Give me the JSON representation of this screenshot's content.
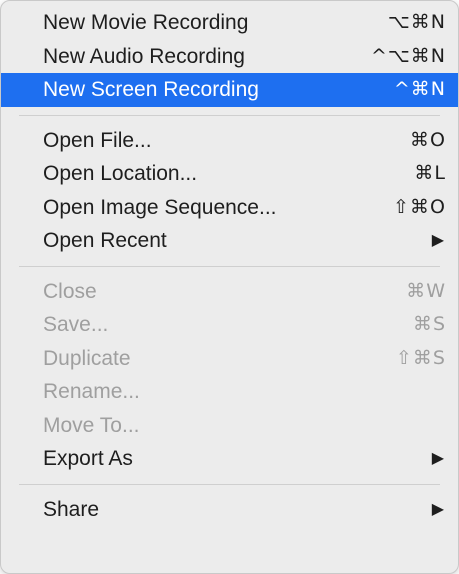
{
  "menu": {
    "groups": [
      [
        {
          "label": "New Movie Recording",
          "shortcut": "⌥⌘N",
          "state": "normal"
        },
        {
          "label": "New Audio Recording",
          "shortcut": "^⌥⌘N",
          "state": "normal"
        },
        {
          "label": "New Screen Recording",
          "shortcut": "^⌘N",
          "state": "highlighted"
        }
      ],
      [
        {
          "label": "Open File...",
          "shortcut": "⌘O",
          "state": "normal"
        },
        {
          "label": "Open Location...",
          "shortcut": "⌘L",
          "state": "normal"
        },
        {
          "label": "Open Image Sequence...",
          "shortcut": "⇧⌘O",
          "state": "normal"
        },
        {
          "label": "Open Recent",
          "submenu_arrow": "▶",
          "state": "normal"
        }
      ],
      [
        {
          "label": "Close",
          "shortcut": "⌘W",
          "state": "disabled"
        },
        {
          "label": "Save...",
          "shortcut": "⌘S",
          "state": "disabled"
        },
        {
          "label": "Duplicate",
          "shortcut": "⇧⌘S",
          "state": "disabled"
        },
        {
          "label": "Rename...",
          "state": "disabled"
        },
        {
          "label": "Move To...",
          "state": "disabled"
        },
        {
          "label": "Export As",
          "submenu_arrow": "▶",
          "state": "normal"
        }
      ],
      [
        {
          "label": "Share",
          "submenu_arrow": "▶",
          "state": "normal"
        }
      ]
    ],
    "colors": {
      "highlight": "#1e6ff0",
      "background": "#ececec",
      "disabled_text": "#9f9f9f"
    }
  }
}
